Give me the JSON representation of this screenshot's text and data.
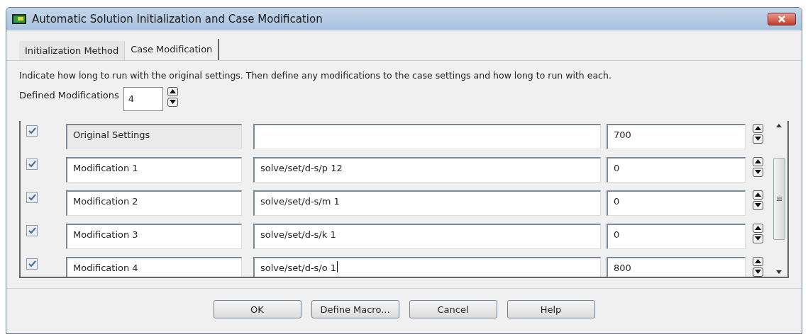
{
  "window": {
    "title": "Automatic Solution Initialization and Case Modification"
  },
  "tabs": [
    {
      "label": "Initialization Method",
      "selected": false
    },
    {
      "label": "Case Modification",
      "selected": true
    }
  ],
  "instructions": "Indicate how long to run with the original settings. Then define any modifications to the case settings and how long to run with each.",
  "defined_modifications": {
    "label": "Defined Modifications",
    "value": "4"
  },
  "rows": [
    {
      "checked": true,
      "name": "Original Settings",
      "name_editable": false,
      "command": "",
      "iterations": "700",
      "focused": false
    },
    {
      "checked": true,
      "name": "Modification 1",
      "name_editable": true,
      "command": "solve/set/d-s/p 12",
      "iterations": "0",
      "focused": false
    },
    {
      "checked": true,
      "name": "Modification 2",
      "name_editable": true,
      "command": "solve/set/d-s/m 1",
      "iterations": "0",
      "focused": false
    },
    {
      "checked": true,
      "name": "Modification 3",
      "name_editable": true,
      "command": "solve/set/d-s/k 1",
      "iterations": "0",
      "focused": false
    },
    {
      "checked": true,
      "name": "Modification 4",
      "name_editable": true,
      "command": "solve/set/d-s/o 1",
      "iterations": "800",
      "focused": true
    }
  ],
  "buttons": [
    "OK",
    "Define Macro...",
    "Cancel",
    "Help"
  ]
}
